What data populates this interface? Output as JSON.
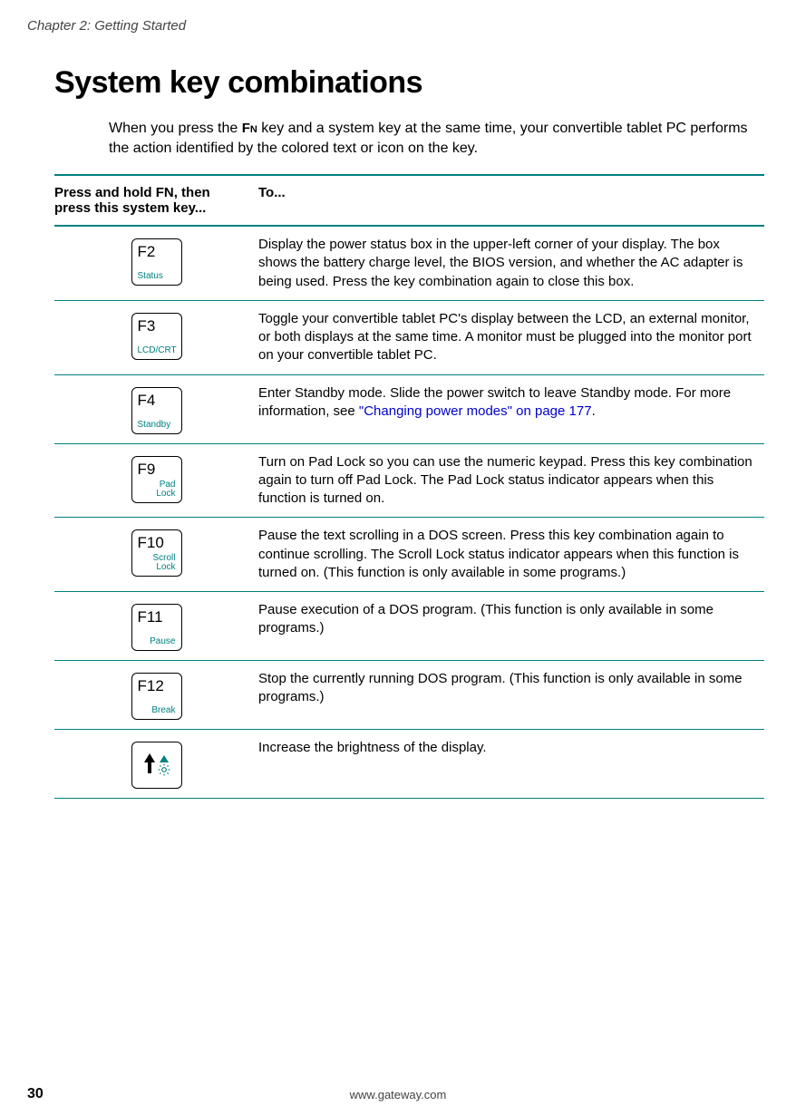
{
  "chapter": "Chapter 2: Getting Started",
  "title": "System key combinations",
  "intro": {
    "pre": "When you press the ",
    "fn": "Fn",
    "post": " key and a system key at the same time, your convertible tablet PC performs the action identified by the colored text or icon on the key."
  },
  "header": {
    "left_pre": "Press and hold ",
    "left_fn": "FN",
    "left_post": ", then press this system key...",
    "right": "To..."
  },
  "rows": [
    {
      "key_main": "F2",
      "key_sub": "Status",
      "sub_align": "left",
      "desc": "Display the power status box in the upper-left corner of your display. The box shows the battery charge level, the BIOS version, and whether the AC adapter is being used. Press the key combination again to close this box."
    },
    {
      "key_main": "F3",
      "key_sub": "LCD/CRT",
      "sub_align": "left",
      "desc": "Toggle your convertible tablet PC's display between the LCD, an external monitor, or both displays at the same time. A monitor must be plugged into the monitor port on your convertible tablet PC."
    },
    {
      "key_main": "F4",
      "key_sub": "Standby",
      "sub_align": "left",
      "desc_pre": "Enter Standby mode. Slide the power switch to leave Standby mode. For more information, see ",
      "desc_link": "\"Changing power modes\" on page 177",
      "desc_post": "."
    },
    {
      "key_main": "F9",
      "key_sub": "Pad\nLock",
      "sub_align": "right",
      "desc": "Turn on Pad Lock so you can use the numeric keypad. Press this key combination again to turn off Pad Lock. The Pad Lock status indicator appears when this function is turned on."
    },
    {
      "key_main": "F10",
      "key_sub": "Scroll\nLock",
      "sub_align": "right",
      "desc": "Pause the text scrolling in a DOS screen. Press this key combination again to continue scrolling. The Scroll Lock status indicator appears when this function is turned on. (This function is only available in some programs.)"
    },
    {
      "key_main": "F11",
      "key_sub": "Pause",
      "sub_align": "right",
      "desc": "Pause execution of a DOS program. (This function is only available in some programs.)"
    },
    {
      "key_main": "F12",
      "key_sub": "Break",
      "sub_align": "right",
      "desc": "Stop the currently running DOS program. (This function is only available in some programs.)"
    },
    {
      "special": "brightness",
      "desc": "Increase the brightness of the display."
    }
  ],
  "footer": {
    "page": "30",
    "url": "www.gateway.com"
  }
}
